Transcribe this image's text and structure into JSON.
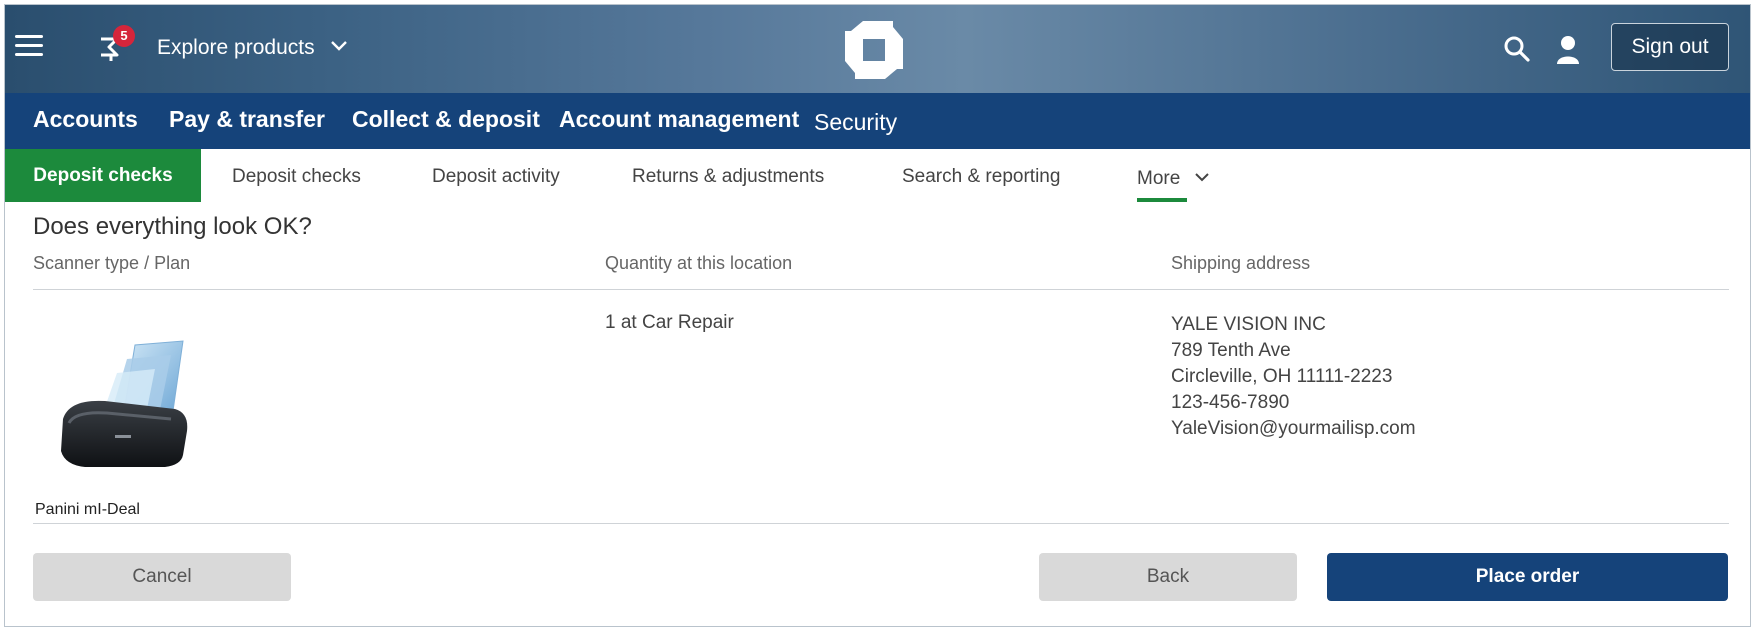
{
  "header": {
    "promo_badge_count": "5",
    "explore_label": "Explore products",
    "signout_label": "Sign out"
  },
  "main_nav": {
    "items": [
      "Accounts",
      "Pay & transfer",
      "Collect & deposit",
      "Account management",
      "Security"
    ]
  },
  "sub_nav": {
    "active": "Deposit checks",
    "items": [
      "Deposit checks",
      "Deposit activity",
      "Returns & adjustments",
      "Search & reporting",
      "More"
    ]
  },
  "review": {
    "question": "Does everything look OK?",
    "columns": [
      "Scanner type / Plan",
      "Quantity at this location",
      "Shipping address"
    ],
    "scanner_name": "Panini mI-Deal",
    "quantity": "1 at Car Repair",
    "address": {
      "name": "YALE VISION INC",
      "street": "789 Tenth Ave",
      "city": "Circleville, OH 11111-2223",
      "phone": "123-456-7890",
      "email": "YaleVision@yourmailisp.com"
    }
  },
  "actions": {
    "cancel": "Cancel",
    "back": "Back",
    "place_order": "Place order"
  },
  "colors": {
    "nav_blue": "#15437a",
    "accent_green": "#1c8a3c",
    "badge_red": "#d5253b",
    "button_gray": "#d9d9d9"
  },
  "icons": [
    "menu-icon",
    "promo-icon",
    "chevron-down-icon",
    "chase-logo-icon",
    "search-icon",
    "user-icon"
  ]
}
